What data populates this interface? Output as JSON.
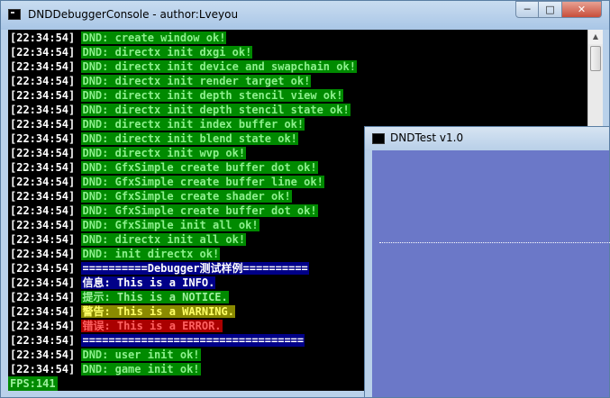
{
  "console": {
    "title": "DNDDebuggerConsole - author:Lveyou",
    "lines": [
      {
        "ts": "[22:34:54]",
        "msg": "DND: create window ok!",
        "style": "green"
      },
      {
        "ts": "[22:34:54]",
        "msg": "DND: directx init dxgi ok!",
        "style": "green"
      },
      {
        "ts": "[22:34:54]",
        "msg": "DND: directx init device and swapchain ok!",
        "style": "green"
      },
      {
        "ts": "[22:34:54]",
        "msg": "DND: directx init render target ok!",
        "style": "green"
      },
      {
        "ts": "[22:34:54]",
        "msg": "DND: directx init depth stencil view ok!",
        "style": "green"
      },
      {
        "ts": "[22:34:54]",
        "msg": "DND: directx init depth stencil state ok!",
        "style": "green"
      },
      {
        "ts": "[22:34:54]",
        "msg": "DND: directx init index buffer ok!",
        "style": "green"
      },
      {
        "ts": "[22:34:54]",
        "msg": "DND: directx init blend state ok!",
        "style": "green"
      },
      {
        "ts": "[22:34:54]",
        "msg": "DND: directx init wvp ok!",
        "style": "green"
      },
      {
        "ts": "[22:34:54]",
        "msg": "DND: GfxSimple create buffer dot ok!",
        "style": "green"
      },
      {
        "ts": "[22:34:54]",
        "msg": "DND: GfxSimple create buffer line ok!",
        "style": "green"
      },
      {
        "ts": "[22:34:54]",
        "msg": "DND: GfxSimple create shader ok!",
        "style": "green"
      },
      {
        "ts": "[22:34:54]",
        "msg": "DND: GfxSimple create buffer dot ok!",
        "style": "green"
      },
      {
        "ts": "[22:34:54]",
        "msg": "DND: GfxSimple init all ok!",
        "style": "green"
      },
      {
        "ts": "[22:34:54]",
        "msg": "DND: directx init all ok!",
        "style": "green"
      },
      {
        "ts": "[22:34:54]",
        "msg": "DND: init directx ok!",
        "style": "green"
      },
      {
        "ts": "[22:34:54]",
        "msg": "==========Debugger测试样例==========",
        "style": "blue"
      },
      {
        "ts": "[22:34:54]",
        "msg": "信息: This is a INFO.",
        "style": "info"
      },
      {
        "ts": "[22:34:54]",
        "msg": "提示: This is a NOTICE.",
        "style": "notice"
      },
      {
        "ts": "[22:34:54]",
        "msg": "警告: This is a WARNING.",
        "style": "warning"
      },
      {
        "ts": "[22:34:54]",
        "msg": "错误: This is a ERROR.",
        "style": "error"
      },
      {
        "ts": "[22:34:54]",
        "msg": "==================================",
        "style": "blue"
      },
      {
        "ts": "[22:34:54]",
        "msg": "DND: user init ok!",
        "style": "green"
      },
      {
        "ts": "[22:34:54]",
        "msg": "DND: game init ok!",
        "style": "green"
      }
    ],
    "fps": "FPS:141",
    "buttons": {
      "min": "─",
      "max": "□",
      "close": "✕"
    }
  },
  "test_window": {
    "title": "DNDTest v1.0",
    "client_color": "#6b78c8"
  },
  "colors": {
    "green_bg": "#008a00",
    "blue_bg": "#000088",
    "warning_bg": "#8a8a00",
    "error_bg": "#aa0000"
  }
}
